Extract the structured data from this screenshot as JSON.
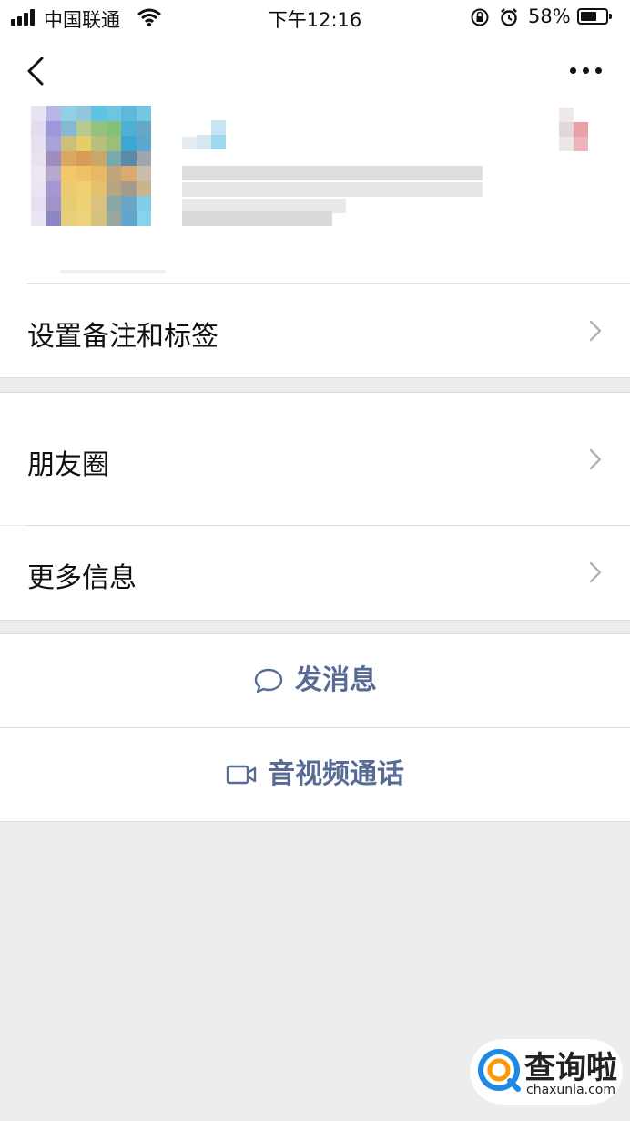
{
  "status_bar": {
    "carrier": "中国联通",
    "time": "下午12:16",
    "battery": "58%"
  },
  "icons": {
    "back": "chevron-left-icon",
    "more": "ellipsis-icon",
    "chat": "speech-bubble-icon",
    "video": "video-camera-icon"
  },
  "menu": {
    "remark_tags": "设置备注和标签",
    "moments": "朋友圈",
    "more_info": "更多信息"
  },
  "actions": {
    "send_message": "发消息",
    "video_call": "音视频通话"
  },
  "watermark": {
    "title": "查询啦",
    "url": "chaxunla.com"
  },
  "colors": {
    "link_blue": "#576b95",
    "background": "#ededed"
  }
}
